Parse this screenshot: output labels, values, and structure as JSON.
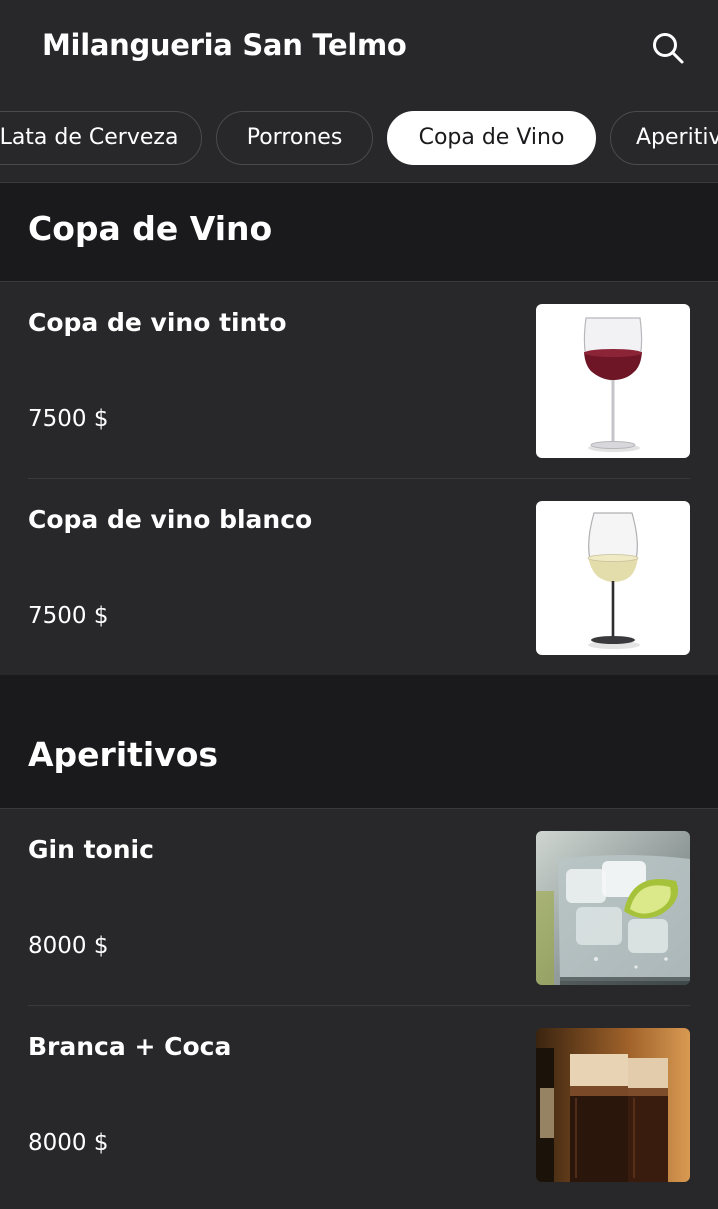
{
  "header": {
    "title": "Milangueria San Telmo",
    "search_icon": "search-icon"
  },
  "tabs": [
    {
      "label": "Lata de Cerveza",
      "active": false
    },
    {
      "label": "Porrones",
      "active": false
    },
    {
      "label": "Copa de Vino",
      "active": true
    },
    {
      "label": "Aperitivos",
      "active": false
    }
  ],
  "sections": [
    {
      "title": "Copa de Vino",
      "items": [
        {
          "name": "Copa de vino tinto",
          "price": "7500 $",
          "image": "red-wine-glass-image"
        },
        {
          "name": "Copa de vino blanco",
          "price": "7500 $",
          "image": "white-wine-glass-image"
        }
      ]
    },
    {
      "title": "Aperitivos",
      "items": [
        {
          "name": "Gin tonic",
          "price": "8000 $",
          "image": "gin-tonic-image"
        },
        {
          "name": "Branca + Coca",
          "price": "8000 $",
          "image": "branca-coca-image"
        }
      ]
    }
  ],
  "colors": {
    "background": "#1a1a1c",
    "surface": "#28282b",
    "divider": "#3a3a3e",
    "active_tab_bg": "#ffffff",
    "text": "#ffffff"
  }
}
